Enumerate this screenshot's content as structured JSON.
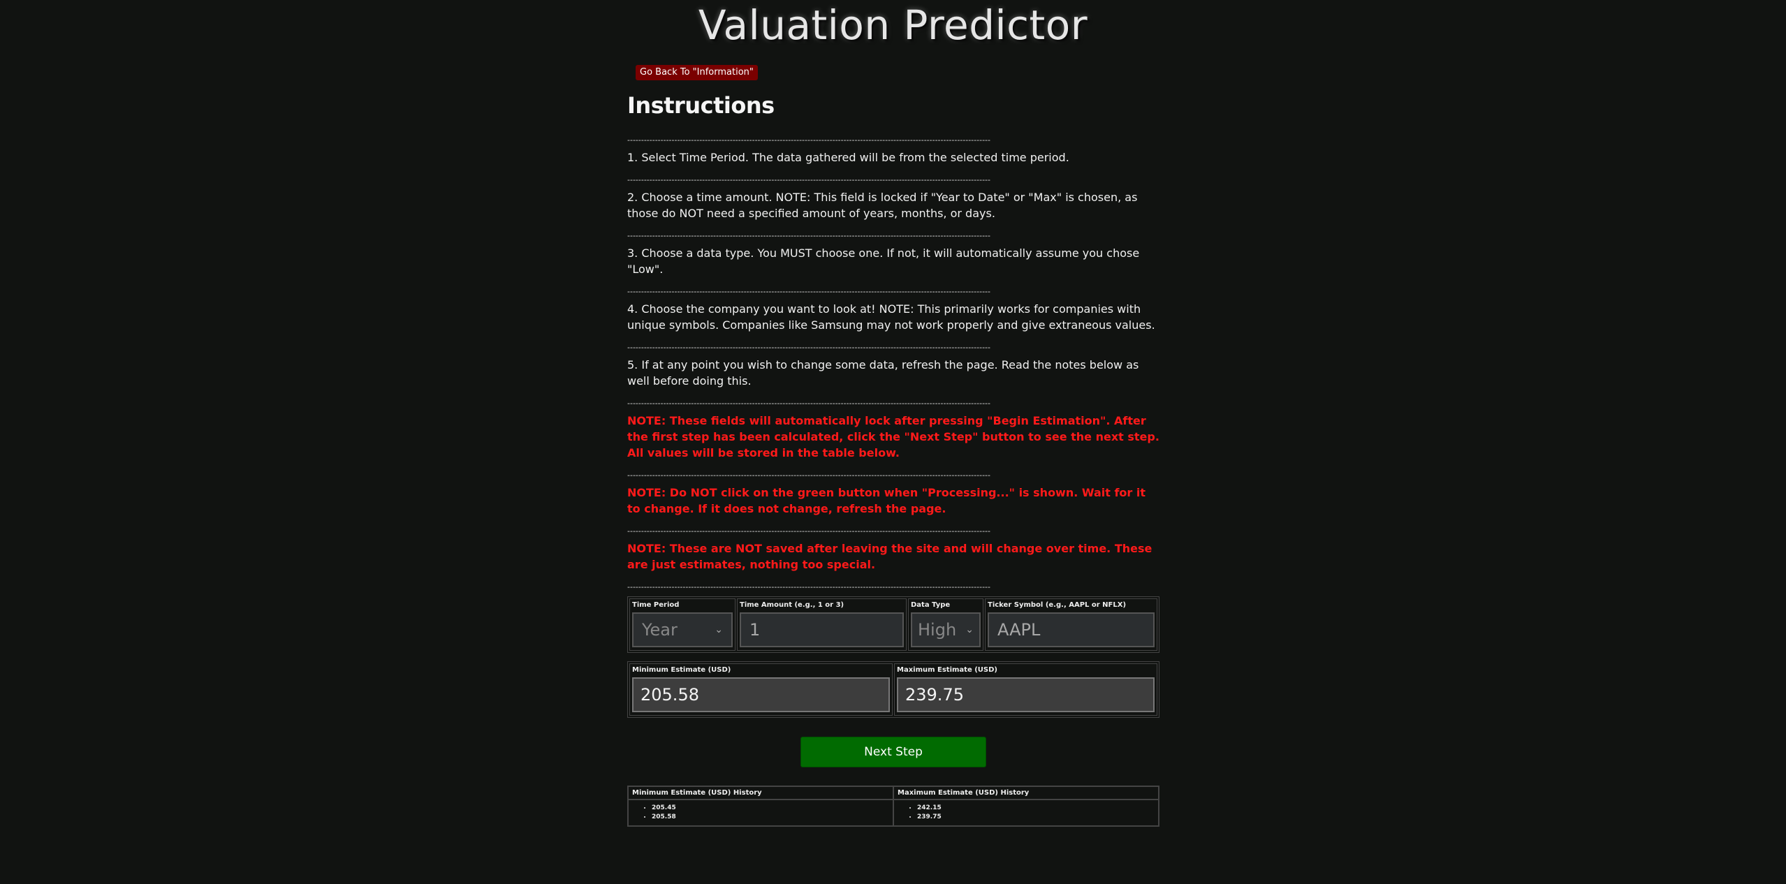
{
  "page": {
    "title": "Valuation Predictor",
    "back_button": "Go Back To \"Information\"",
    "heading": "Instructions"
  },
  "divider": "---------------------------------------------------------------------------------------------------------------------------------------------------------------",
  "instructions": [
    "1. Select Time Period. The data gathered will be from the selected time period.",
    "2. Choose a time amount. NOTE: This field is locked if \"Year to Date\" or \"Max\" is chosen, as those do NOT need a specified amount of years, months, or days.",
    "3. Choose a data type. You MUST choose one. If not, it will automatically assume you chose \"Low\".",
    "4. Choose the company you want to look at! NOTE: This primarily works for companies with unique symbols. Companies like Samsung may not work properly and give extraneous values.",
    "5. If at any point you wish to change some data, refresh the page. Read the notes below as well before doing this."
  ],
  "notes": [
    "NOTE: These fields will automatically lock after pressing \"Begin Estimation\". After the first step has been calculated, click the \"Next Step\" button to see the next step. All values will be stored in the table below.",
    "NOTE: Do NOT click on the green button when \"Processing...\" is shown. Wait for it to change. If it does not change, refresh the page.",
    "NOTE: These are NOT saved after leaving the site and will change over time. These are just estimates, nothing too special."
  ],
  "form": {
    "time_period_label": "Time Period",
    "time_period_value": "Year",
    "time_amount_label": "Time Amount (e.g., 1 or 3)",
    "time_amount_value": "1",
    "data_type_label": "Data Type",
    "data_type_value": "High",
    "ticker_label": "Ticker Symbol (e.g., AAPL or NFLX)",
    "ticker_value": "AAPL"
  },
  "estimates": {
    "min_label": "Minimum Estimate (USD)",
    "min_value": "205.58",
    "max_label": "Maximum Estimate (USD)",
    "max_value": "239.75"
  },
  "next_button": "Next Step",
  "history": {
    "min_header": "Minimum Estimate (USD) History",
    "max_header": "Maximum Estimate (USD) History",
    "min_values": [
      "205.45",
      "205.58"
    ],
    "max_values": [
      "242.15",
      "239.75"
    ]
  },
  "colors": {
    "background": "#111311",
    "note_red": "#ff1a1a",
    "back_button": "#7a0000",
    "next_button": "#016b01"
  }
}
